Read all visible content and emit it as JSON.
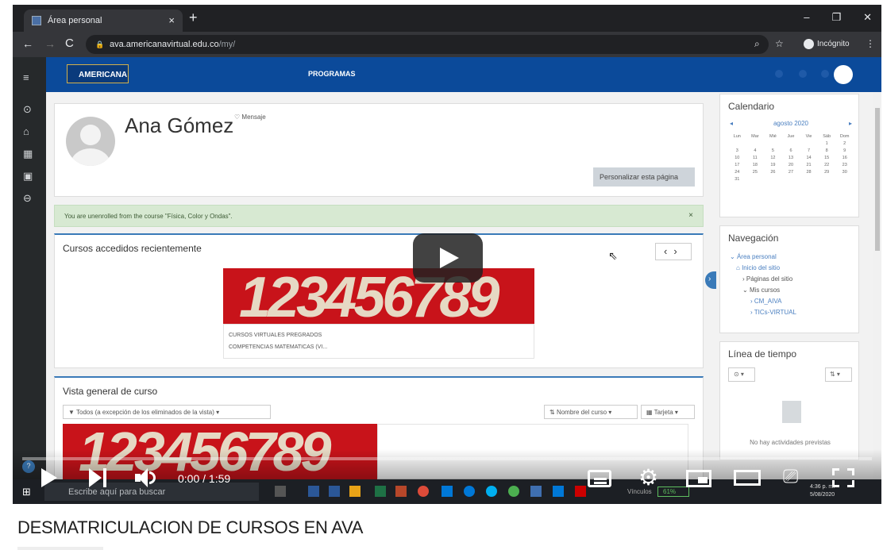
{
  "browser": {
    "tab_title": "Área personal",
    "new_tab": "+",
    "tab_close": "×",
    "window_controls": [
      "–",
      "❐",
      "✕"
    ],
    "url_host": "ava.americanavirtual.edu.co",
    "url_path": "/my/",
    "incognito_label": "Incógnito"
  },
  "moodle": {
    "logo_text": "AMERICANA",
    "nav_programs": "PROGRAMAS",
    "profile_name": "Ana Gómez",
    "message_label": "Mensaje",
    "customize_button": "Personalizar esta página",
    "alert_text": "You are unenrolled from the course \"Física, Color y Ondas\".",
    "alert_close": "×",
    "recent": {
      "heading": "Cursos accedidos recientemente",
      "image_text": "123456789",
      "category": "CURSOS VIRTUALES PREGRADOS",
      "course": "COMPETENCIAS MATEMATICAS (VI..."
    },
    "overview": {
      "heading": "Vista general de curso",
      "filter": "Todos (a excepción de los eliminados de la vista)",
      "sort": "Nombre del curso",
      "view": "Tarjeta",
      "image_text": "123456789"
    },
    "calendar": {
      "title": "Calendario",
      "month": "agosto 2020",
      "days": [
        "Lun",
        "Mar",
        "Mié",
        "Jue",
        "Vie",
        "Sáb",
        "Dom"
      ],
      "dates": [
        "",
        "",
        "",
        "",
        "",
        "1",
        "2",
        "3",
        "4",
        "5",
        "6",
        "7",
        "8",
        "9",
        "10",
        "11",
        "12",
        "13",
        "14",
        "15",
        "16",
        "17",
        "18",
        "19",
        "20",
        "21",
        "22",
        "23",
        "24",
        "25",
        "26",
        "27",
        "28",
        "29",
        "30",
        "31",
        "",
        "",
        "",
        "",
        "",
        ""
      ]
    },
    "navigation": {
      "title": "Navegación",
      "items": [
        "Área personal",
        "Inicio del sitio",
        "Páginas del sitio",
        "Mis cursos",
        "CM_AIVA",
        "TICs-VIRTUAL"
      ]
    },
    "timeline": {
      "title": "Línea de tiempo",
      "empty": "No hay actividades previstas"
    }
  },
  "taskbar": {
    "search_placeholder": "Escribe aquí para buscar",
    "vinculos": "Vínculos",
    "battery": "61%",
    "time": "4:36 p. m.",
    "date": "5/08/2020"
  },
  "player": {
    "timecode": "0:00 / 1:59",
    "progress": 0
  },
  "video_title": "DESMATRICULACION DE CURSOS EN AVA"
}
